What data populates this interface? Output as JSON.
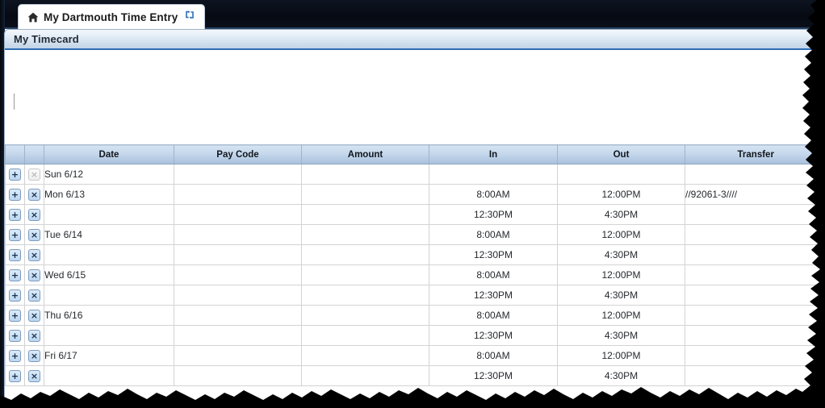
{
  "window": {
    "tab": {
      "title": "My Dartmouth Time Entry",
      "home_icon": "home-icon",
      "refresh_icon": "refresh-icon"
    }
  },
  "panel": {
    "header_title": "My Timecard"
  },
  "grid": {
    "columns": [
      {
        "key": "add",
        "label": ""
      },
      {
        "key": "remove",
        "label": ""
      },
      {
        "key": "date",
        "label": "Date"
      },
      {
        "key": "pay_code",
        "label": "Pay Code"
      },
      {
        "key": "amount",
        "label": "Amount"
      },
      {
        "key": "in",
        "label": "In"
      },
      {
        "key": "out",
        "label": "Out"
      },
      {
        "key": "transfer",
        "label": "Transfer"
      }
    ],
    "buttons": {
      "add_label": "+",
      "remove_label": "×"
    },
    "rows": [
      {
        "add": "+",
        "remove": "×",
        "remove_disabled": true,
        "date": "Sun 6/12",
        "pay_code": "",
        "amount": "",
        "in": "",
        "out": "",
        "transfer": ""
      },
      {
        "add": "+",
        "remove": "×",
        "remove_disabled": false,
        "date": "Mon 6/13",
        "pay_code": "",
        "amount": "",
        "in": "8:00AM",
        "out": "12:00PM",
        "transfer": "//92061-3////"
      },
      {
        "add": "+",
        "remove": "×",
        "remove_disabled": false,
        "date": "",
        "pay_code": "",
        "amount": "",
        "in": "12:30PM",
        "out": "4:30PM",
        "transfer": ""
      },
      {
        "add": "+",
        "remove": "×",
        "remove_disabled": false,
        "date": "Tue 6/14",
        "pay_code": "",
        "amount": "",
        "in": "8:00AM",
        "out": "12:00PM",
        "transfer": ""
      },
      {
        "add": "+",
        "remove": "×",
        "remove_disabled": false,
        "date": "",
        "pay_code": "",
        "amount": "",
        "in": "12:30PM",
        "out": "4:30PM",
        "transfer": ""
      },
      {
        "add": "+",
        "remove": "×",
        "remove_disabled": false,
        "date": "Wed 6/15",
        "pay_code": "",
        "amount": "",
        "in": "8:00AM",
        "out": "12:00PM",
        "transfer": ""
      },
      {
        "add": "+",
        "remove": "×",
        "remove_disabled": false,
        "date": "",
        "pay_code": "",
        "amount": "",
        "in": "12:30PM",
        "out": "4:30PM",
        "transfer": ""
      },
      {
        "add": "+",
        "remove": "×",
        "remove_disabled": false,
        "date": "Thu 6/16",
        "pay_code": "",
        "amount": "",
        "in": "8:00AM",
        "out": "12:00PM",
        "transfer": ""
      },
      {
        "add": "+",
        "remove": "×",
        "remove_disabled": false,
        "date": "",
        "pay_code": "",
        "amount": "",
        "in": "12:30PM",
        "out": "4:30PM",
        "transfer": ""
      },
      {
        "add": "+",
        "remove": "×",
        "remove_disabled": false,
        "date": "Fri 6/17",
        "pay_code": "",
        "amount": "",
        "in": "8:00AM",
        "out": "12:00PM",
        "transfer": ""
      },
      {
        "add": "+",
        "remove": "×",
        "remove_disabled": false,
        "date": "",
        "pay_code": "",
        "amount": "",
        "in": "12:30PM",
        "out": "4:30PM",
        "transfer": ""
      }
    ]
  },
  "colors": {
    "chrome_black": "#060a12",
    "panel_header_blue": "#2f6db5",
    "grid_header_blue": "#a9c1dd",
    "button_blue": "#bcd6ef",
    "text_dark": "#25292e"
  }
}
